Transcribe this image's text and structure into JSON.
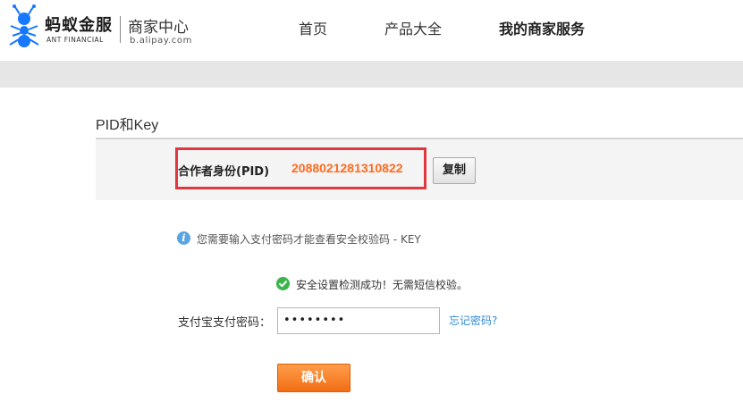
{
  "header": {
    "brand_cn": "蚂蚁金服",
    "brand_en": "ANT FINANCIAL",
    "merchant_center": "商家中心",
    "merchant_url": "b.alipay.com",
    "nav": {
      "home": "首页",
      "products": "产品大全",
      "services": "我的商家服务"
    }
  },
  "section": {
    "title": "PID和Key"
  },
  "pid": {
    "label": "合作者身份(PID)",
    "value": "2088021281310822",
    "copy_label": "复制"
  },
  "notice": {
    "info_icon": "i",
    "info_text": "您需要输入支付密码才能查看安全校验码 - KEY",
    "success_text": "安全设置检测成功！无需短信校验。"
  },
  "form": {
    "password_label": "支付宝支付密码：",
    "password_value": "••••••••",
    "forgot_link": "忘记密码?",
    "confirm_label": "确认"
  },
  "colors": {
    "highlight_border": "#e0383e",
    "pid_value": "#ff6a1f",
    "confirm_button": "#f26d14",
    "link": "#2f8bd8",
    "info_icon": "#5aa5e0",
    "success_icon": "#3bb54a"
  },
  "icons": {
    "logo": "ant-logo-icon",
    "info": "info-icon",
    "success": "check-circle-icon"
  }
}
